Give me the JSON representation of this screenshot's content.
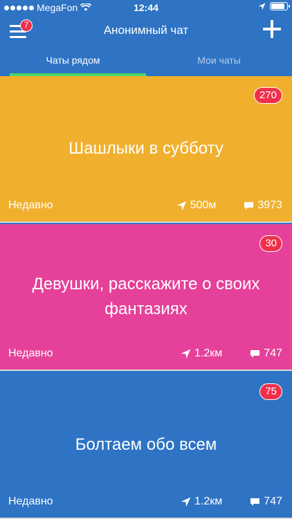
{
  "status_bar": {
    "carrier": "MegaFon",
    "time": "12:44",
    "signal_icon": "signal-dots-icon",
    "wifi_icon": "wifi-icon",
    "location_icon": "location-arrow-icon",
    "battery_icon": "battery-icon",
    "battery_level": 0.9
  },
  "nav": {
    "menu_icon": "menu-icon",
    "notification_count": "7",
    "title": "Анонимный чат",
    "add_icon": "plus-icon"
  },
  "tabs": [
    {
      "label": "Чаты рядом",
      "active": true
    },
    {
      "label": "Мои чаты",
      "active": false
    }
  ],
  "chats": [
    {
      "title": "Шашлыки в субботу",
      "badge": "270",
      "time": "Недавно",
      "distance": "500м",
      "messages": "3973",
      "color": "#f0b02d"
    },
    {
      "title": "Девушки, расскажите о своих фантазиях",
      "badge": "30",
      "time": "Недавно",
      "distance": "1.2км",
      "messages": "747",
      "color": "#e5419a"
    },
    {
      "title": "Болтаем обо всем",
      "badge": "75",
      "time": "Недавно",
      "distance": "1.2км",
      "messages": "747",
      "color": "#2e73c4"
    }
  ],
  "colors": {
    "primary": "#2e73c4",
    "tab_indicator": "#4cd964",
    "badge": "#f0304b"
  }
}
